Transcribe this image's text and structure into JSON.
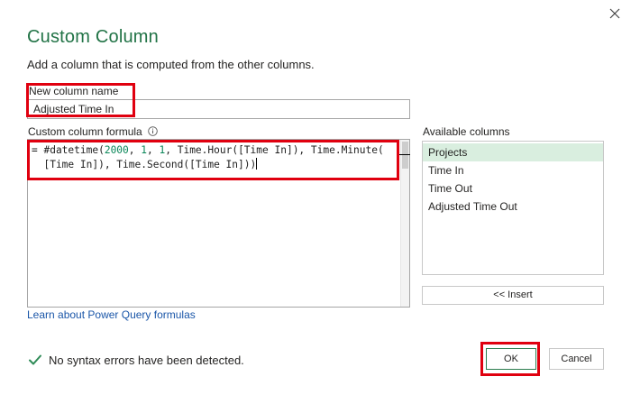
{
  "dialog": {
    "title": "Custom Column",
    "subtitle": "Add a column that is computed from the other columns.",
    "close_icon": "close-icon"
  },
  "new_column": {
    "label": "New column name",
    "value": "Adjusted Time In"
  },
  "formula": {
    "label": "Custom column formula",
    "info_icon": "info-icon",
    "line1_prefix": "= #datetime(",
    "line1_n1": "2000",
    "line1_sep1": ", ",
    "line1_n2": "1",
    "line1_sep2": ", ",
    "line1_n3": "1",
    "line1_rest": ", Time.Hour([Time In]), Time.Minute(",
    "line2": "  [Time In]), Time.Second([Time In]))"
  },
  "available_columns": {
    "label": "Available columns",
    "items": [
      "Projects",
      "Time In",
      "Time Out",
      "Adjusted Time Out"
    ],
    "selected": "Projects",
    "insert_label": "<< Insert"
  },
  "learn_link": "Learn about Power Query formulas",
  "status": {
    "icon": "checkmark-icon",
    "text": "No syntax errors have been detected."
  },
  "buttons": {
    "ok": "OK",
    "cancel": "Cancel"
  },
  "colors": {
    "accent": "#217346",
    "highlight": "#e0000f",
    "selected_row": "#d9eedf",
    "link": "#1a56a8"
  }
}
